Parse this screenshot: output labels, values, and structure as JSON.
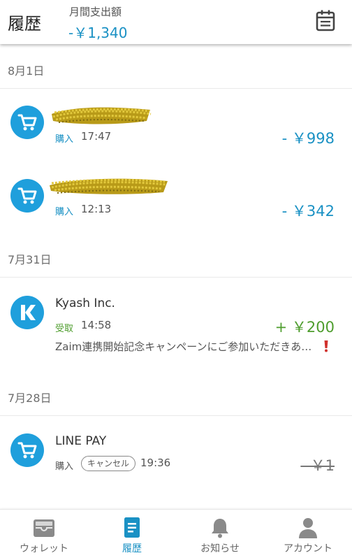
{
  "header": {
    "title": "履歴",
    "month_label": "月間支出額",
    "month_amount": "-￥1,340",
    "calendar_icon": "calendar-icon"
  },
  "dates": [
    "8月1日",
    "7月31日",
    "7月28日"
  ],
  "transactions": [
    {
      "merchant": "",
      "merchant_redacted": true,
      "kind": "購入",
      "time": "17:47",
      "amount": "- ￥998",
      "icon": "shopping-cart-icon",
      "amount_color": "#1a91c4"
    },
    {
      "merchant": "",
      "merchant_redacted": true,
      "kind": "購入",
      "time": "12:13",
      "amount": "- ￥342",
      "icon": "shopping-cart-icon",
      "amount_color": "#1a91c4"
    },
    {
      "merchant": "Kyash Inc.",
      "kind": "受取",
      "time": "14:58",
      "amount": "+ ￥200",
      "memo": "Zaim連携開始記念キャンペーンにご参加いただきあ…",
      "icon": "kyash-logo-icon",
      "amount_color": "#4e9d2d"
    },
    {
      "merchant": "LINE PAY",
      "kind": "購入",
      "status": "キャンセル",
      "time": "19:36",
      "amount": "- ￥1",
      "icon": "shopping-cart-icon",
      "amount_color": "#777777"
    }
  ],
  "tabs": [
    {
      "label": "ウォレット",
      "icon": "wallet-icon",
      "active": false
    },
    {
      "label": "履歴",
      "icon": "history-document-icon",
      "active": true
    },
    {
      "label": "お知らせ",
      "icon": "bell-icon",
      "active": false
    },
    {
      "label": "アカウント",
      "icon": "person-icon",
      "active": false
    }
  ],
  "colors": {
    "accent": "#1a91c4",
    "icon_bg": "#1f9fdc",
    "income": "#4e9d2d",
    "alert": "#d0312d"
  }
}
